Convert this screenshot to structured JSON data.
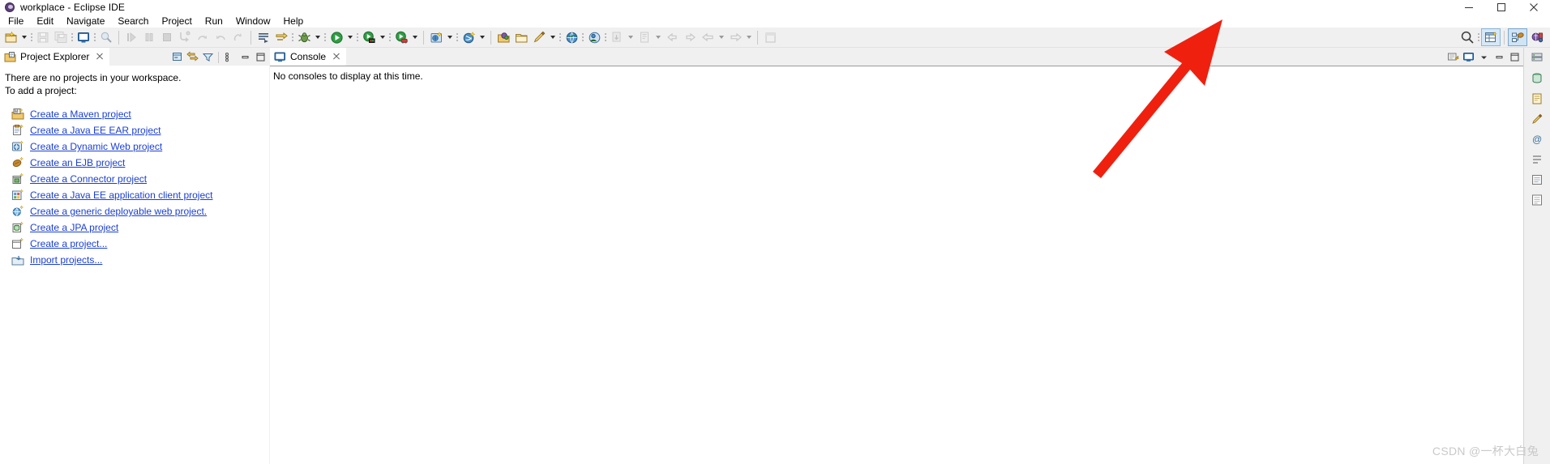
{
  "window": {
    "title": "workplace - Eclipse IDE",
    "app_icon": "eclipse-icon",
    "controls": {
      "minimize": "minimize-icon",
      "maximize": "maximize-icon",
      "close": "close-icon"
    }
  },
  "menubar": {
    "items": [
      {
        "label": "File"
      },
      {
        "label": "Edit"
      },
      {
        "label": "Navigate"
      },
      {
        "label": "Search"
      },
      {
        "label": "Project"
      },
      {
        "label": "Run"
      },
      {
        "label": "Window"
      },
      {
        "label": "Help"
      }
    ]
  },
  "toolbar": {
    "groups": [
      {
        "buttons": [
          {
            "name": "new-wizard-icon",
            "enabled": true,
            "dropdown": true
          },
          {
            "name": "save-icon",
            "enabled": false
          },
          {
            "name": "save-all-icon",
            "enabled": false
          },
          {
            "name": "console-view-icon",
            "enabled": true
          },
          {
            "name": "search-magnifier-icon",
            "enabled": false
          }
        ]
      },
      {
        "buttons": [
          {
            "name": "resume-icon",
            "enabled": false
          },
          {
            "name": "suspend-icon",
            "enabled": false
          },
          {
            "name": "terminate-icon",
            "enabled": false
          },
          {
            "name": "step-into-icon",
            "enabled": false
          },
          {
            "name": "step-over-icon",
            "enabled": false
          },
          {
            "name": "step-return-icon",
            "enabled": false
          },
          {
            "name": "drop-to-frame-icon",
            "enabled": false
          }
        ]
      },
      {
        "buttons": [
          {
            "name": "skip-breakpoints-icon",
            "enabled": true
          },
          {
            "name": "toggle-breakpoint-icon",
            "enabled": true
          },
          {
            "name": "debug-bug-icon",
            "enabled": true,
            "dropdown": true
          },
          {
            "name": "run-icon",
            "enabled": true,
            "dropdown": true
          },
          {
            "name": "run-server-icon",
            "enabled": true,
            "dropdown": true
          },
          {
            "name": "run-profile-icon",
            "enabled": true,
            "dropdown": true
          }
        ]
      },
      {
        "buttons": [
          {
            "name": "new-web-project-icon",
            "enabled": true,
            "dropdown": true
          },
          {
            "name": "new-javascript-icon",
            "enabled": true,
            "dropdown": true
          }
        ]
      },
      {
        "buttons": [
          {
            "name": "open-package-icon",
            "enabled": true
          },
          {
            "name": "open-folder-icon",
            "enabled": true
          },
          {
            "name": "edit-pencil-icon",
            "enabled": true,
            "dropdown": true
          }
        ]
      },
      {
        "buttons": [
          {
            "name": "open-browser-icon",
            "enabled": true
          },
          {
            "name": "open-task-icon",
            "enabled": true
          }
        ]
      },
      {
        "buttons": [
          {
            "name": "previous-annotation-icon",
            "enabled": false,
            "dropdown": true
          },
          {
            "name": "next-annotation-icon",
            "enabled": false,
            "dropdown": true
          },
          {
            "name": "back-history-icon",
            "enabled": false
          },
          {
            "name": "forward-history-icon",
            "enabled": false
          },
          {
            "name": "back-nav-icon",
            "enabled": false,
            "dropdown": true
          },
          {
            "name": "forward-nav-icon",
            "enabled": false,
            "dropdown": true
          }
        ]
      },
      {
        "buttons": [
          {
            "name": "pin-editor-icon",
            "enabled": false
          }
        ]
      }
    ],
    "right": {
      "quick_access_icon": "search-icon",
      "perspectives": [
        {
          "name": "open-perspective-icon",
          "state": "active"
        },
        {
          "name": "perspective-java-ee-icon",
          "state": "selected"
        },
        {
          "name": "perspective-java-icon",
          "state": "normal"
        }
      ]
    }
  },
  "project_explorer": {
    "tab_label": "Project Explorer",
    "tab_icon": "project-explorer-icon",
    "close_icon": "close-icon",
    "tools": [
      {
        "name": "collapse-all-icon"
      },
      {
        "name": "link-with-editor-icon"
      },
      {
        "name": "view-filter-icon"
      },
      {
        "name": "view-menu-icon"
      },
      {
        "name": "minimize-view-icon"
      },
      {
        "name": "maximize-view-icon"
      }
    ],
    "empty_message_line1": "There are no projects in your workspace.",
    "empty_message_line2": "To add a project:",
    "links": [
      {
        "icon": "maven-project-icon",
        "label": "Create a Maven project"
      },
      {
        "icon": "ear-project-icon",
        "label": "Create a Java EE EAR project"
      },
      {
        "icon": "dynamic-web-project-icon",
        "label": "Create a Dynamic Web project"
      },
      {
        "icon": "ejb-project-icon",
        "label": "Create an EJB project"
      },
      {
        "icon": "connector-project-icon",
        "label": "Create a Connector project"
      },
      {
        "icon": "app-client-project-icon",
        "label": "Create a Java EE application client project"
      },
      {
        "icon": "generic-web-project-icon",
        "label": "Create a generic deployable web project."
      },
      {
        "icon": "jpa-project-icon",
        "label": "Create a JPA project"
      },
      {
        "icon": "new-project-icon",
        "label": "Create a project..."
      },
      {
        "icon": "import-projects-icon",
        "label": "Import projects..."
      }
    ]
  },
  "console": {
    "tab_label": "Console",
    "tab_icon": "console-icon",
    "close_icon": "close-icon",
    "message": "No consoles to display at this time.",
    "tools": [
      {
        "name": "open-console-icon"
      },
      {
        "name": "display-selected-console-icon"
      },
      {
        "name": "console-menu-arrow-icon"
      },
      {
        "name": "minimize-view-icon"
      },
      {
        "name": "maximize-view-icon"
      }
    ]
  },
  "right_fastview": {
    "items": [
      {
        "name": "servers-view-icon"
      },
      {
        "name": "data-source-explorer-icon"
      },
      {
        "name": "snippets-view-icon"
      },
      {
        "name": "properties-view-icon"
      },
      {
        "name": "markers-view-icon"
      },
      {
        "name": "outline-view-icon"
      },
      {
        "name": "tasks-view-icon"
      },
      {
        "name": "problems-view-icon"
      }
    ]
  },
  "annotation": {
    "arrow": "red-arrow-pointer",
    "color": "#f01f0f"
  },
  "watermark": {
    "text": "CSDN @一杯大白兔",
    "color": "#c9c9c9"
  }
}
